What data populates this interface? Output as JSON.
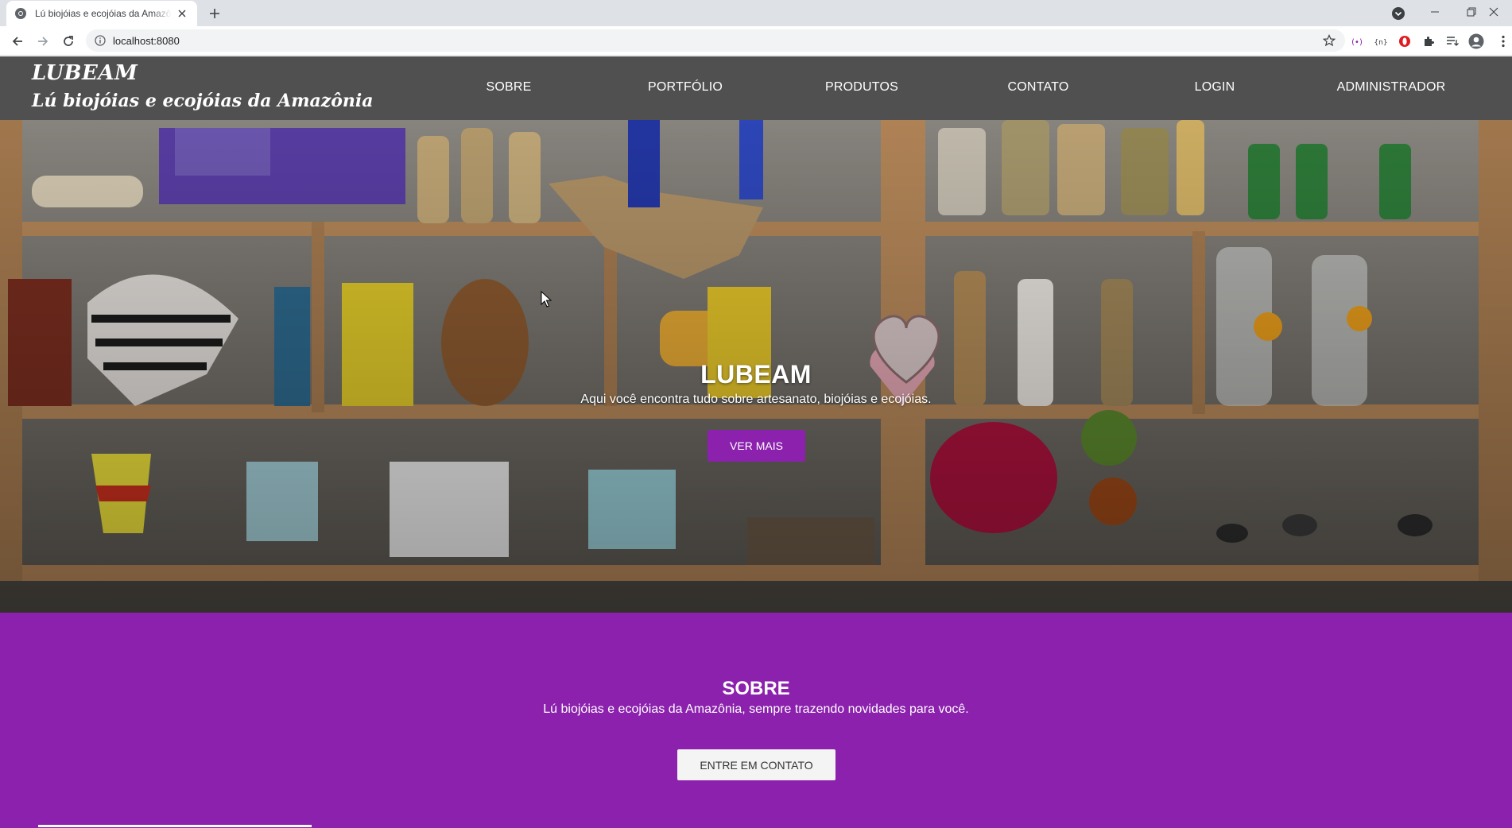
{
  "browser": {
    "tab_title": "Lú biojóias e ecojóias da Amazônia",
    "url": "localhost:8080"
  },
  "site": {
    "brand_name": "LUBEAM",
    "brand_tagline": "Lú biojóias e ecojóias da Amazônia",
    "nav": [
      {
        "label": "SOBRE"
      },
      {
        "label": "PORTFÓLIO"
      },
      {
        "label": "PRODUTOS"
      },
      {
        "label": "CONTATO"
      },
      {
        "label": "LOGIN"
      },
      {
        "label": "ADMINISTRADOR"
      }
    ]
  },
  "hero": {
    "title": "LUBEAM",
    "subtitle": "Aqui você encontra tudo sobre artesanato, biojóias e ecojóias.",
    "button": "VER MAIS"
  },
  "about": {
    "title": "SOBRE",
    "text": "Lú biojóias e ecojóias da Amazônia, sempre trazendo novidades para você.",
    "button": "ENTRE EM CONTATO"
  },
  "colors": {
    "header_bg": "#505050",
    "accent_purple": "#8b21ad",
    "light_button": "#f4f4f4"
  },
  "icons": [
    "chrome-favicon",
    "close-icon",
    "plus-icon",
    "back-icon",
    "forward-icon",
    "reload-icon",
    "info-icon",
    "star-icon",
    "extensions-icon",
    "avatar-icon",
    "minimize-icon",
    "maximize-icon",
    "window-close-icon"
  ]
}
